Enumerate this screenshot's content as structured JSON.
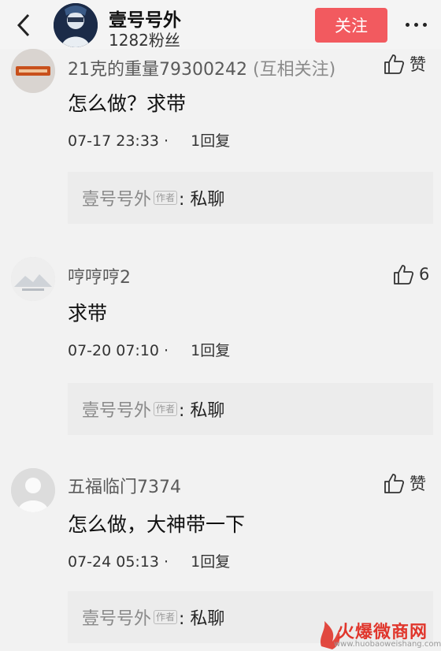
{
  "header": {
    "author_name": "壹号号外",
    "fans": "1282粉丝",
    "follow_label": "关注"
  },
  "comments": [
    {
      "name": "21克的重量79300242",
      "name_suffix": "(互相关注)",
      "text": "怎么做？求带",
      "time": "07-17 23:33",
      "replies": "1回复",
      "like": "赞",
      "reply_author": "壹号号外",
      "author_tag": "作者",
      "reply_text": ": 私聊"
    },
    {
      "name": "哼哼哼2",
      "name_suffix": "",
      "text": "求带",
      "time": "07-20 07:10",
      "replies": "1回复",
      "like": "6",
      "reply_author": "壹号号外",
      "author_tag": "作者",
      "reply_text": ": 私聊"
    },
    {
      "name": "五福临门7374",
      "name_suffix": "",
      "text": "怎么做，大神带一下",
      "time": "07-24 05:13",
      "replies": "1回复",
      "like": "赞",
      "reply_author": "壹号号外",
      "author_tag": "作者",
      "reply_text": ": 私聊"
    }
  ],
  "watermark": {
    "text": "火爆微商网",
    "url": "www.huobaoweishang.com"
  },
  "colors": {
    "follow_button": "#f25a5f",
    "background": "#f2f2f2",
    "reply_box": "#ececec"
  }
}
